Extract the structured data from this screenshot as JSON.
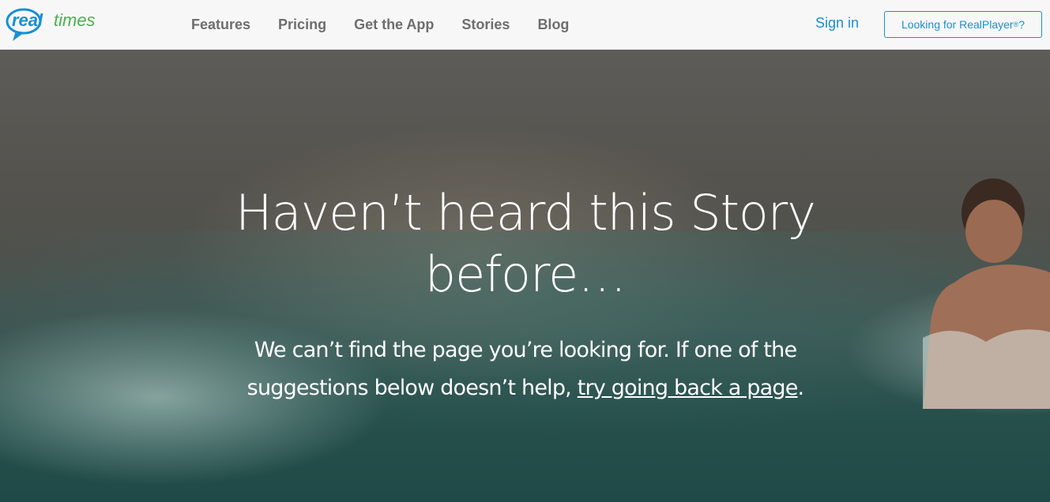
{
  "brand": {
    "logo_text_real": "real",
    "logo_text_times": "times",
    "logo_color_blue": "#1a8fd1",
    "logo_color_green": "#4caf50"
  },
  "nav": {
    "links": [
      "Features",
      "Pricing",
      "Get the App",
      "Stories",
      "Blog"
    ],
    "sign_in": "Sign in",
    "realplayer_button_prefix": "Looking for RealPlayer",
    "realplayer_button_reg": "®",
    "realplayer_button_suffix": "?"
  },
  "hero": {
    "title": "Haven’t heard this Story before…",
    "subtitle_prefix": "We can’t find the page you’re looking for. If one of the suggestions below doesn’t help, ",
    "back_link": "try going back a page",
    "subtitle_suffix": "."
  },
  "colors": {
    "accent": "#1a8fd1",
    "nav_text": "#6e6e6e",
    "nav_bg": "#f7f7f7"
  }
}
